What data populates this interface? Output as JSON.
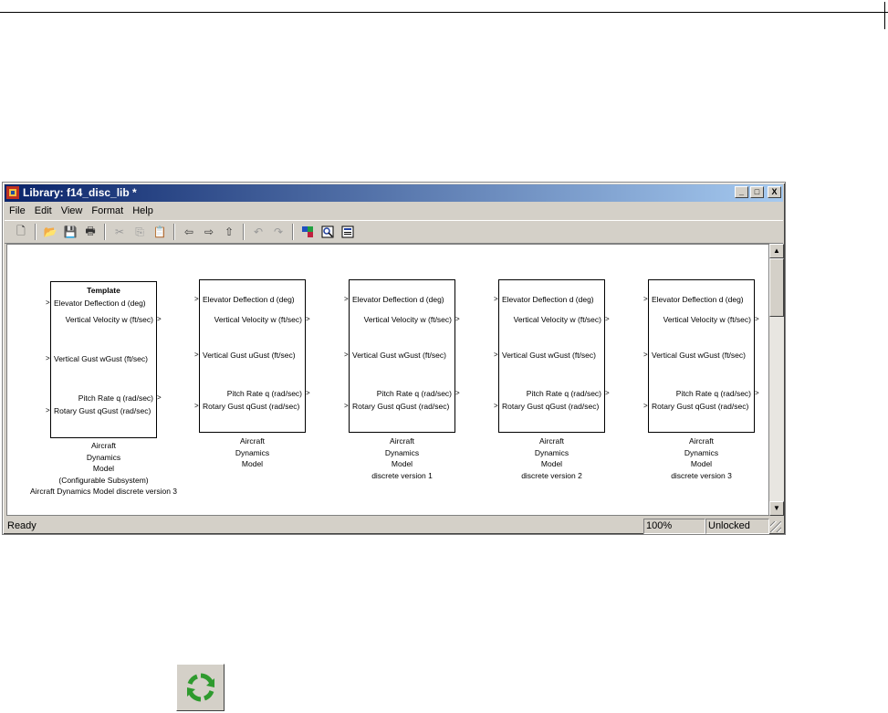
{
  "window": {
    "title": "Library: f14_disc_lib *",
    "controls": {
      "minimize": "_",
      "maximize": "□",
      "close": "X"
    }
  },
  "menubar": [
    "File",
    "Edit",
    "View",
    "Format",
    "Help"
  ],
  "toolbar_icons": [
    "new-icon",
    "open-icon",
    "save-icon",
    "print-icon",
    "cut-icon",
    "copy-icon",
    "paste-icon",
    "back-icon",
    "forward-icon",
    "up-icon",
    "undo-icon",
    "redo-icon",
    "library-browser-icon",
    "model-explorer-icon",
    "debugger-icon"
  ],
  "blocks": [
    {
      "header": "Template",
      "inputs": [
        "Elevator Deflection d (deg)",
        "Vertical Gust wGust (ft/sec)",
        "Rotary Gust qGust (rad/sec)"
      ],
      "outputs": [
        "Vertical Velocity w (ft/sec)",
        "Pitch Rate q (rad/sec)"
      ],
      "caption": [
        "Aircraft",
        "Dynamics",
        "Model",
        "(Configurable Subsystem)",
        "Aircraft Dynamics Model discrete version 3"
      ]
    },
    {
      "inputs": [
        "Elevator Deflection d (deg)",
        "Vertical Gust uGust (ft/sec)",
        "Rotary Gust qGust (rad/sec)"
      ],
      "outputs": [
        "Vertical Velocity w (ft/sec)",
        "Pitch Rate q (rad/sec)"
      ],
      "caption": [
        "Aircraft",
        "Dynamics",
        "Model"
      ]
    },
    {
      "inputs": [
        "Elevator Deflection d (deg)",
        "Vertical Gust wGust (ft/sec)",
        "Rotary Gust qGust (rad/sec)"
      ],
      "outputs": [
        "Vertical Velocity w (ft/sec)",
        "Pitch Rate q (rad/sec)"
      ],
      "caption": [
        "Aircraft",
        "Dynamics",
        "Model",
        "discrete version 1"
      ]
    },
    {
      "inputs": [
        "Elevator Deflection d (deg)",
        "Vertical Gust wGust (ft/sec)",
        "Rotary Gust qGust (rad/sec)"
      ],
      "outputs": [
        "Vertical Velocity w (ft/sec)",
        "Pitch Rate q (rad/sec)"
      ],
      "caption": [
        "Aircraft",
        "Dynamics",
        "Model",
        "discrete version 2"
      ]
    },
    {
      "inputs": [
        "Elevator Deflection d (deg)",
        "Vertical Gust wGust (ft/sec)",
        "Rotary Gust qGust (rad/sec)"
      ],
      "outputs": [
        "Vertical Velocity w (ft/sec)",
        "Pitch Rate q (rad/sec)"
      ],
      "caption": [
        "Aircraft",
        "Dynamics",
        "Model",
        "discrete version 3"
      ]
    }
  ],
  "statusbar": {
    "status": "Ready",
    "zoom": "100%",
    "lock": "Unlocked"
  },
  "refresh_button": {
    "icon": "refresh-icon",
    "color": "#2e9a2e"
  }
}
